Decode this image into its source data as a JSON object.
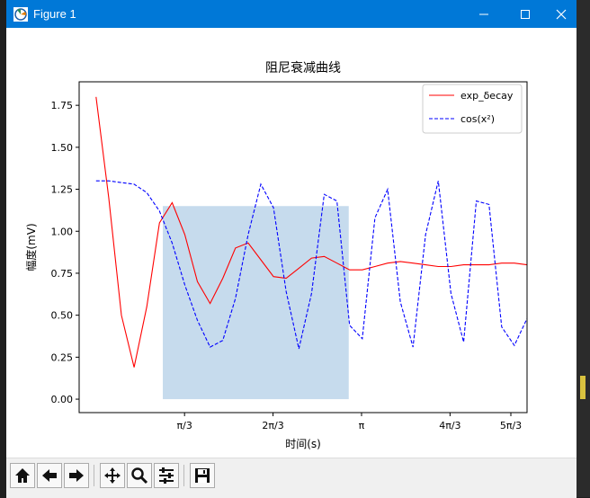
{
  "window": {
    "title": "Figure 1",
    "controls": [
      "minimize",
      "maximize",
      "close"
    ]
  },
  "toolbar": {
    "buttons": [
      {
        "name": "home-icon",
        "label": "Home"
      },
      {
        "name": "back-icon",
        "label": "Back"
      },
      {
        "name": "forward-icon",
        "label": "Forward"
      },
      {
        "name": "pan-icon",
        "label": "Pan"
      },
      {
        "name": "zoom-icon",
        "label": "Zoom"
      },
      {
        "name": "configure-subplots-icon",
        "label": "Configure"
      },
      {
        "name": "save-icon",
        "label": "Save"
      }
    ]
  },
  "chart_data": {
    "type": "line",
    "title": "阻尼衰减曲线",
    "xlabel": "时间(s)",
    "ylabel": "幅度(mV)",
    "xlim": [
      -0.2,
      5.1
    ],
    "ylim": [
      -0.08,
      1.89
    ],
    "xticks": [
      {
        "value": 1.0472,
        "label": "π/3"
      },
      {
        "value": 2.0944,
        "label": "2π/3"
      },
      {
        "value": 3.1416,
        "label": "π"
      },
      {
        "value": 4.1888,
        "label": "4π/3"
      },
      {
        "value": 5.236,
        "label": "5π/3"
      }
    ],
    "yticks": [
      0.0,
      0.25,
      0.5,
      0.75,
      1.0,
      1.25,
      1.5,
      1.75
    ],
    "ytick_labels": [
      "0.00",
      "0.25",
      "0.50",
      "0.75",
      "1.00",
      "1.25",
      "1.50",
      "1.75"
    ],
    "x": [
      0.0,
      0.15,
      0.3,
      0.45,
      0.6,
      0.75,
      0.9,
      1.05,
      1.2,
      1.35,
      1.5,
      1.65,
      1.8,
      1.95,
      2.1,
      2.25,
      2.4,
      2.55,
      2.7,
      2.85,
      3.0,
      3.15,
      3.3,
      3.45,
      3.6,
      3.75,
      3.9,
      4.05,
      4.2,
      4.35,
      4.5,
      4.65,
      4.8,
      4.95,
      5.1
    ],
    "series": [
      {
        "name": "exp_δecay",
        "color": "#ff0000",
        "style": "solid",
        "values": [
          1.8,
          1.2,
          0.5,
          0.19,
          0.55,
          1.05,
          1.17,
          0.98,
          0.7,
          0.57,
          0.72,
          0.9,
          0.93,
          0.83,
          0.73,
          0.72,
          0.78,
          0.84,
          0.85,
          0.81,
          0.77,
          0.77,
          0.79,
          0.81,
          0.82,
          0.81,
          0.8,
          0.79,
          0.79,
          0.8,
          0.8,
          0.8,
          0.81,
          0.81,
          0.8
        ]
      },
      {
        "name": "cos(x²)",
        "color": "#0000ff",
        "style": "dashed",
        "values": [
          1.3,
          1.3,
          1.29,
          1.28,
          1.23,
          1.12,
          0.93,
          0.68,
          0.47,
          0.31,
          0.35,
          0.6,
          0.98,
          1.28,
          1.14,
          0.64,
          0.3,
          0.63,
          1.22,
          1.18,
          0.44,
          0.36,
          1.08,
          1.25,
          0.58,
          0.31,
          0.98,
          1.3,
          0.63,
          0.34,
          1.18,
          1.16,
          0.43,
          0.32,
          0.48
        ]
      }
    ],
    "fill_between": {
      "x_start": 0.79,
      "x_end": 2.99,
      "y_top": 1.15,
      "color": "#c6dbed"
    },
    "legend": {
      "position": "top-right",
      "entries": [
        "exp_δecay",
        "cos(x²)"
      ]
    },
    "grid": false
  }
}
